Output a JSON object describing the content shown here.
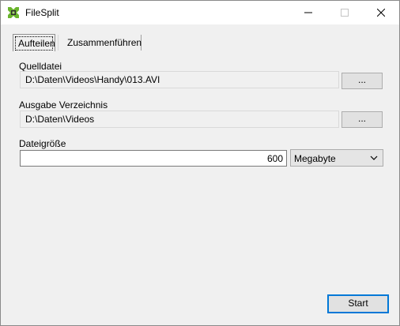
{
  "window": {
    "title": "FileSplit"
  },
  "tabs": [
    {
      "label": "Aufteilen",
      "active": true
    },
    {
      "label": "Zusammenführen",
      "active": false
    }
  ],
  "source": {
    "label": "Quelldatei",
    "value": "D:\\Daten\\Videos\\Handy\\013.AVI",
    "browse_label": "..."
  },
  "output": {
    "label": "Ausgabe Verzeichnis",
    "value": "D:\\Daten\\Videos",
    "browse_label": "..."
  },
  "filesize": {
    "label": "Dateigröße",
    "value": "600",
    "unit": "Megabyte"
  },
  "actions": {
    "start_label": "Start"
  },
  "icons": {
    "app": "app-split-icon",
    "minimize": "minimize-icon",
    "maximize": "maximize-icon",
    "close": "close-icon",
    "dropdown": "chevron-down-icon"
  },
  "colors": {
    "focus_border": "#0078d7",
    "app_icon": "#6ab42d"
  }
}
